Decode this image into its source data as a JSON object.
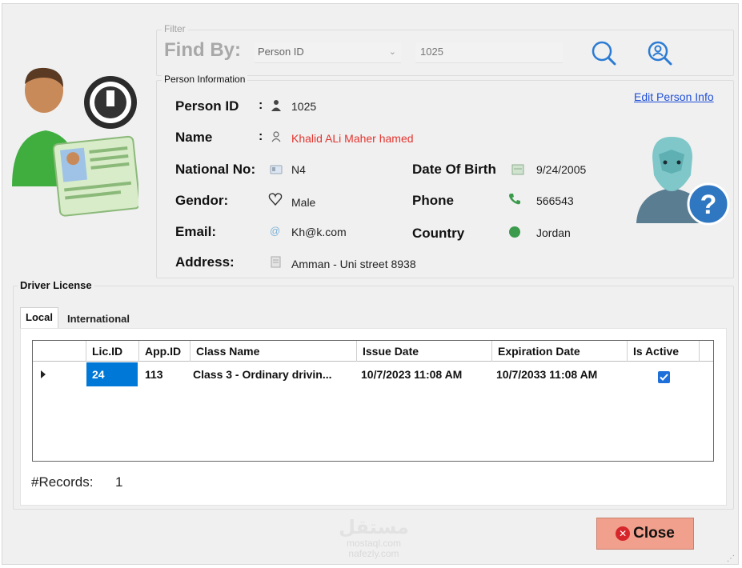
{
  "filter": {
    "legend": "Filter",
    "find_by_label": "Find By:",
    "find_by_selected": "Person ID",
    "search_value": "1025"
  },
  "person": {
    "legend": "Person Information",
    "edit_link": "Edit Person Info",
    "labels": {
      "person_id": "Person ID",
      "name": "Name",
      "national_no": "National No:",
      "date_of_birth": "Date Of Birth",
      "gendor": "Gendor:",
      "phone": "Phone",
      "email": "Email:",
      "country": "Country",
      "address": "Address:"
    },
    "values": {
      "person_id": "1025",
      "name": "Khalid ALi Maher hamed",
      "national_no": "N4",
      "date_of_birth": "9/24/2005",
      "gendor": "Male",
      "phone": "566543",
      "email": "Kh@k.com",
      "country": "Jordan",
      "address": "Amman - Uni street 8938"
    },
    "colon": ":"
  },
  "license": {
    "legend": "Driver License",
    "tabs": [
      "Local",
      "International"
    ],
    "columns": [
      "Lic.ID",
      "App.ID",
      "Class Name",
      "Issue Date",
      "Expiration Date",
      "Is Active"
    ],
    "rows": [
      {
        "lic_id": "24",
        "app_id": "113",
        "class_name": "Class 3 - Ordinary drivin...",
        "issue_date": "10/7/2023 11:08 AM",
        "expiration_date": "10/7/2033 11:08 AM",
        "is_active": true
      }
    ],
    "records_label": "#Records:",
    "records_count": "1"
  },
  "close_label": "Close",
  "watermark": {
    "arabic": "مستقل",
    "line1": "mostaql.com",
    "line2": "nafezly.com"
  },
  "colors": {
    "accent_blue": "#0078d7",
    "name_red": "#e3342f",
    "close_bg": "#f0a08c",
    "link_blue": "#1f4fd8"
  },
  "icons": {
    "license_avatar": "person-license-icon",
    "unknown_person": "unknown-person-icon",
    "search": "search-icon",
    "search_person": "search-person-icon",
    "close": "close-icon"
  }
}
